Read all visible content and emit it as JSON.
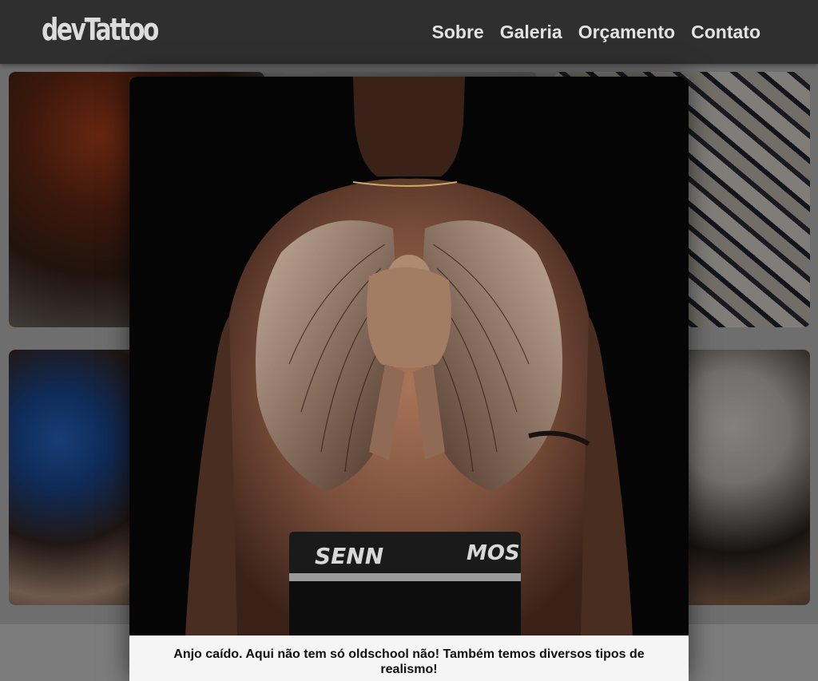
{
  "header": {
    "logo": "devTattoo",
    "nav": [
      "Sobre",
      "Galeria",
      "Orçamento",
      "Contato"
    ]
  },
  "modal": {
    "caption": "Anjo caído. Aqui não tem só oldschool não! Também temos diversos tipos de realismo!",
    "waistband_left": "SENN",
    "waistband_right": "MOS"
  },
  "colors": {
    "header_bg": "#2f2f2f",
    "overlay": "#7a7a7a",
    "caption_bg": "#f5f5f5"
  }
}
